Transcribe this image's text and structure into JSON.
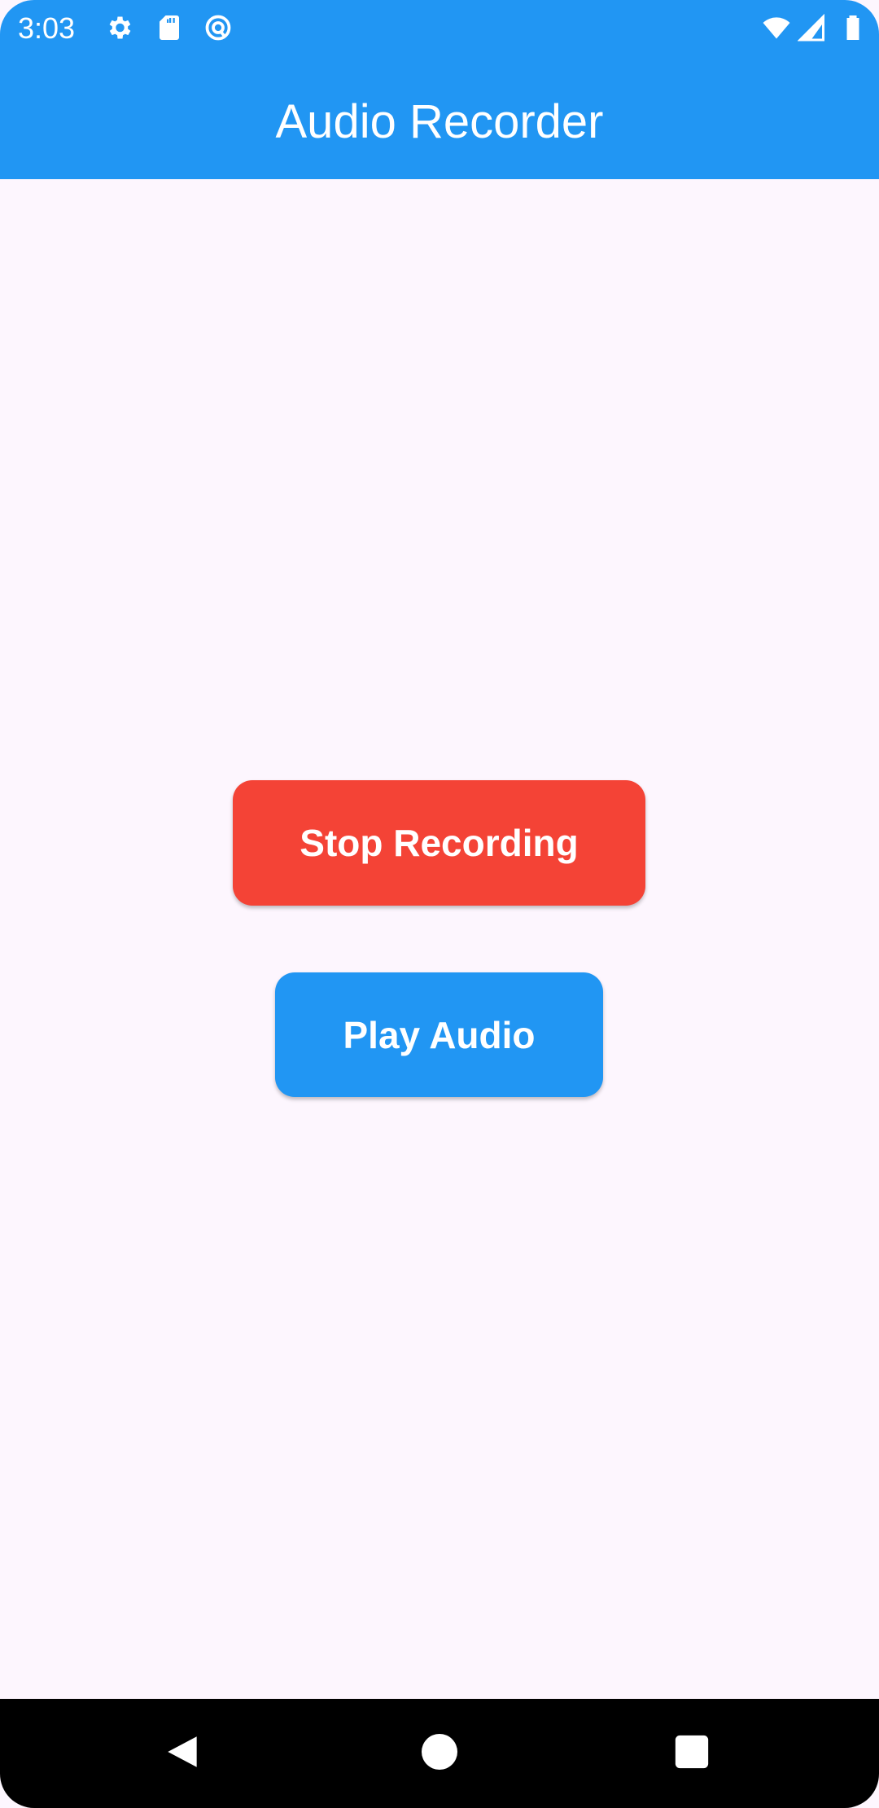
{
  "status_bar": {
    "time": "3:03",
    "icons": [
      "gear-icon",
      "sd-card-icon",
      "at-sign-icon",
      "wifi-icon",
      "signal-icon",
      "battery-icon"
    ]
  },
  "app_bar": {
    "title": "Audio Recorder"
  },
  "main": {
    "stop_label": "Stop Recording",
    "play_label": "Play Audio"
  },
  "colors": {
    "primary": "#2196f3",
    "stop": "#f44336",
    "background": "#fdf6fe"
  },
  "nav_bar": {
    "icons": [
      "back-icon",
      "home-icon",
      "recents-icon"
    ]
  }
}
